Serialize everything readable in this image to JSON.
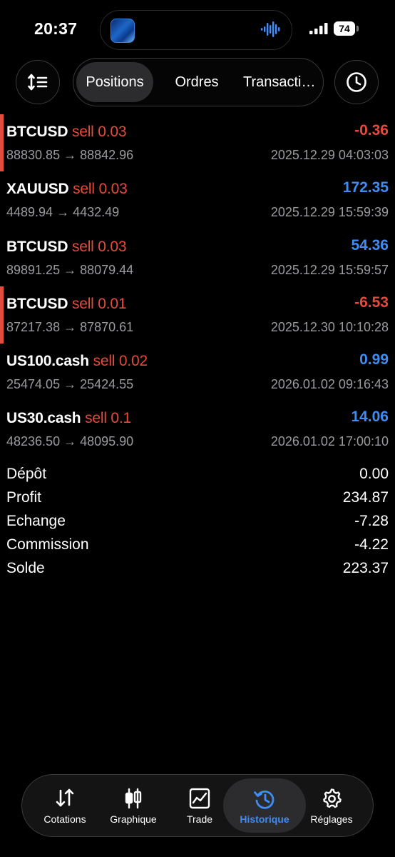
{
  "status_bar": {
    "time": "20:37",
    "battery": "74"
  },
  "segments": {
    "positions": "Positions",
    "orders": "Ordres",
    "transactions": "Transacti…"
  },
  "positions": [
    {
      "symbol": "BTCUSD",
      "side": "sell 0.03",
      "profit": "-0.36",
      "profit_type": "loss",
      "prices": "88830.85 → 88842.96",
      "datetime": "2025.12.29 04:03:03",
      "marked": true
    },
    {
      "symbol": "XAUUSD",
      "side": "sell 0.03",
      "profit": "172.35",
      "profit_type": "gain",
      "prices": "4489.94 → 4432.49",
      "datetime": "2025.12.29 15:59:39",
      "marked": false
    },
    {
      "symbol": "BTCUSD",
      "side": "sell 0.03",
      "profit": "54.36",
      "profit_type": "gain",
      "prices": "89891.25 → 88079.44",
      "datetime": "2025.12.29 15:59:57",
      "marked": false
    },
    {
      "symbol": "BTCUSD",
      "side": "sell 0.01",
      "profit": "-6.53",
      "profit_type": "loss",
      "prices": "87217.38 → 87870.61",
      "datetime": "2025.12.30 10:10:28",
      "marked": true
    },
    {
      "symbol": "US100.cash",
      "side": "sell 0.02",
      "profit": "0.99",
      "profit_type": "gain",
      "prices": "25474.05 → 25424.55",
      "datetime": "2026.01.02 09:16:43",
      "marked": false
    },
    {
      "symbol": "US30.cash",
      "side": "sell 0.1",
      "profit": "14.06",
      "profit_type": "gain",
      "prices": "48236.50 → 48095.90",
      "datetime": "2026.01.02 17:00:10",
      "marked": false
    }
  ],
  "summary": [
    {
      "label": "Dépôt",
      "value": "0.00"
    },
    {
      "label": "Profit",
      "value": "234.87"
    },
    {
      "label": "Echange",
      "value": "-7.28"
    },
    {
      "label": "Commission",
      "value": "-4.22"
    },
    {
      "label": "Solde",
      "value": "223.37"
    }
  ],
  "tabbar": {
    "quotes": "Cotations",
    "chart": "Graphique",
    "trade": "Trade",
    "history": "Historique",
    "settings": "Réglages"
  },
  "colors": {
    "loss": "#e64a3b",
    "gain": "#3f8cf5",
    "active_tab": "#3f8cf5",
    "background": "#000000"
  },
  "icons": {
    "sort": "sort-icon",
    "history": "clock-icon",
    "quotes": "arrows-up-down-icon",
    "chart": "candlestick-icon",
    "trade": "line-chart-icon",
    "history_tab": "history-icon",
    "settings": "gear-icon"
  }
}
